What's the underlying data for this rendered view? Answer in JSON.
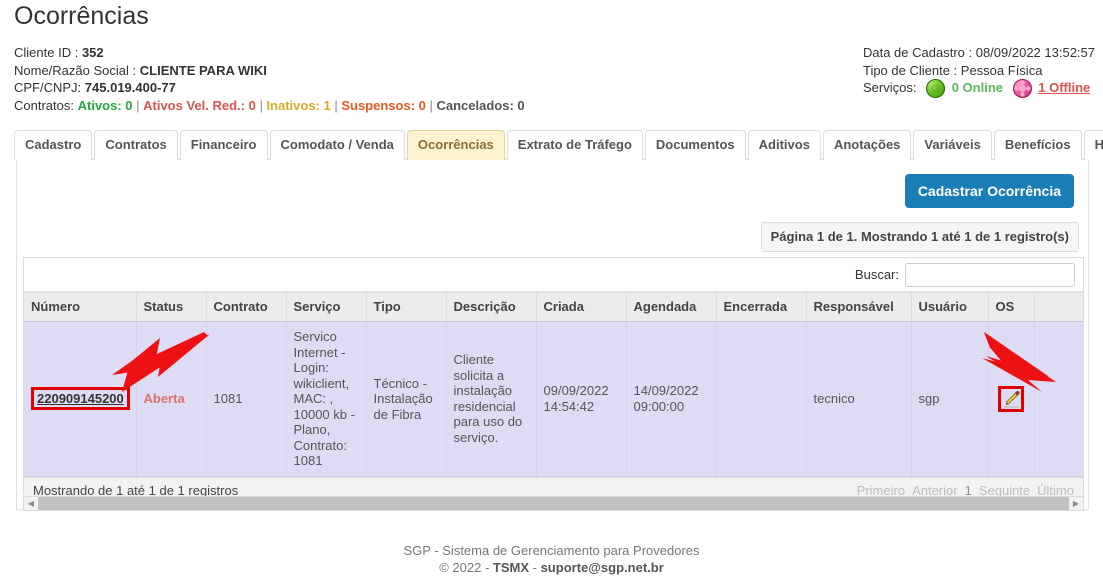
{
  "page_title": "Ocorrências",
  "client": {
    "id_label": "Cliente ID :",
    "id_value": "352",
    "name_label": "Nome/Razão Social :",
    "name_value": "CLIENTE PARA WIKI",
    "doc_label": "CPF/CNPJ:",
    "doc_value": "745.019.400-77",
    "contracts_label": "Contratos:",
    "contracts": [
      {
        "label": "Ativos:",
        "value": "0",
        "color": "#28a745"
      },
      {
        "label": "Ativos Vel. Red.:",
        "value": "0",
        "color": "#d9534f"
      },
      {
        "label": "Inativos:",
        "value": "1",
        "color": "#d4ac2b"
      },
      {
        "label": "Suspensos:",
        "value": "0",
        "color": "#e8591f"
      },
      {
        "label": "Cancelados:",
        "value": "0",
        "color": "#555555"
      }
    ],
    "contracts_text": {
      "ativos": "Ativos: 0",
      "ativos_vel_red": "Ativos Vel. Red.: 0",
      "inativos": "Inativos: 1",
      "suspensos": "Suspensos: 0",
      "cancelados": "Cancelados: 0"
    }
  },
  "meta": {
    "date_label": "Data de Cadastro :",
    "date_value": "08/09/2022 13:52:57",
    "date_line": "Data de Cadastro : 08/09/2022 13:52:57",
    "type_line": "Tipo de Cliente : Pessoa Física",
    "services_label": "Serviços:",
    "online_text": "0 Online",
    "offline_text": "1 Offline",
    "online_icon": "green-circle-icon",
    "offline_icon": "pink-dizzy-circle-icon"
  },
  "tabs": [
    {
      "label": "Cadastro",
      "active": false
    },
    {
      "label": "Contratos",
      "active": false
    },
    {
      "label": "Financeiro",
      "active": false
    },
    {
      "label": "Comodato / Venda",
      "active": false
    },
    {
      "label": "Ocorrências",
      "active": true
    },
    {
      "label": "Extrato de Tráfego",
      "active": false
    },
    {
      "label": "Documentos",
      "active": false
    },
    {
      "label": "Aditivos",
      "active": false
    },
    {
      "label": "Anotações",
      "active": false
    },
    {
      "label": "Variáveis",
      "active": false
    },
    {
      "label": "Benefícios",
      "active": false
    },
    {
      "label": "Histórico",
      "active": false
    }
  ],
  "toolbar": {
    "create_button": "Cadastrar Ocorrência",
    "page_info": "Página 1 de 1. Mostrando 1 até 1 de 1 registro(s)"
  },
  "search": {
    "label": "Buscar:",
    "value": "",
    "placeholder": ""
  },
  "table": {
    "columns": [
      "Número",
      "Status",
      "Contrato",
      "Serviço",
      "Tipo",
      "Descrição",
      "Criada",
      "Agendada",
      "Encerrada",
      "Responsável",
      "Usuário",
      "OS",
      ""
    ],
    "rows": [
      {
        "numero": "220909145200",
        "status": "Aberta",
        "contrato": "1081",
        "servico": "Servico Internet - Login: wikiclient, MAC: , 10000 kb - Plano, Contrato: 1081",
        "tipo": "Técnico - Instalação de Fibra",
        "descricao": "Cliente solicita a instalação residencial para uso do serviço.",
        "criada": "09/09/2022 14:54:42",
        "agendada": "14/09/2022 09:00:00",
        "encerrada": "",
        "responsavel": "tecnico",
        "usuario": "sgp",
        "os_icon": "pencil-edit-icon",
        "extra": ""
      }
    ],
    "footer_info": "Mostrando de 1 até 1 de 1 registros",
    "pager": {
      "first": "Primeiro",
      "previous": "Anterior",
      "current": "1",
      "next": "Seguinte",
      "last": "Último"
    }
  },
  "footer": {
    "line1": "SGP - Sistema de Gerenciamento para Provedores",
    "copyright": "© 2022 - ",
    "brand": "TSMX",
    "dash": " - ",
    "email": "suporte@sgp.net.br"
  },
  "annotations": {
    "arrow_color": "#ee1111",
    "highlight_color": "#e00000",
    "arrow1_target": "numero-cell",
    "arrow2_target": "os-cell"
  },
  "colors": {
    "accent_button": "#1a7db5",
    "active_tab_bg": "#fcf2cf",
    "row_bg": "#dedcf5"
  }
}
